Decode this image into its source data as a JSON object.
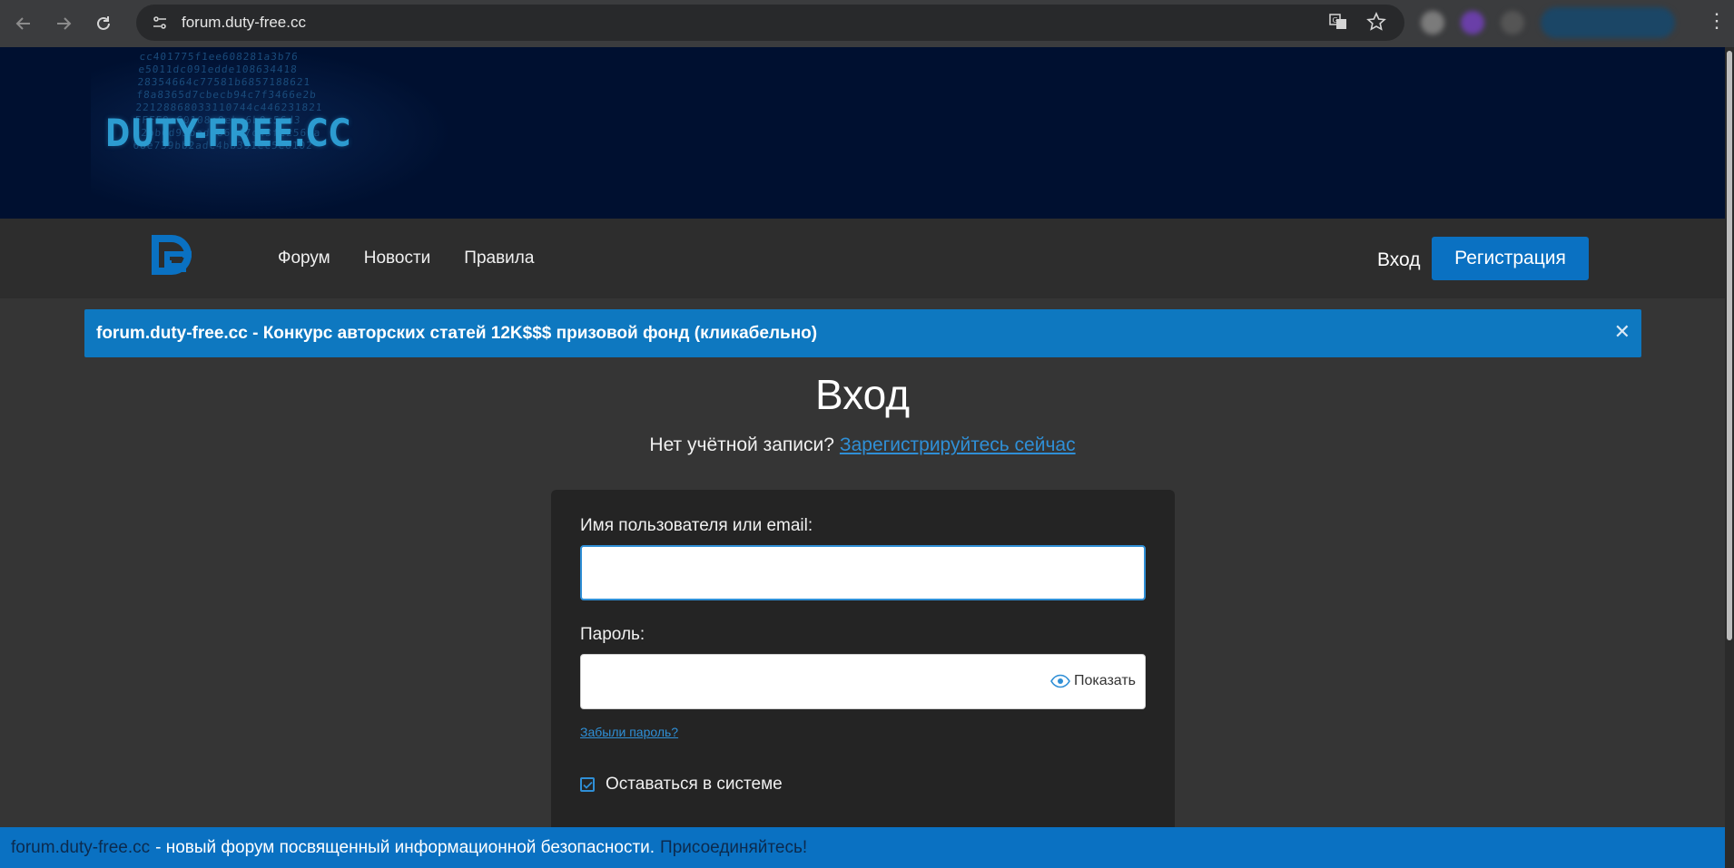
{
  "browser": {
    "url": "forum.duty-free.cc"
  },
  "banner": {
    "logo_text": "DUTY-FREE.CC",
    "code_lines": [
      "cc401775f1ee608281a3b76",
      "e5011dc091edde108634418",
      "28354664c77581b6857188621",
      "f8a8365d7cbecb94c7f3466e2b",
      "22128868033110744c446231821",
      "FFFE9e60108e9ebc6b0c56d3",
      "a2bb6d93bade867f7c43f2256ca",
      "68e739bb2adc4bb391ec5e6102"
    ]
  },
  "nav": {
    "links": [
      "Форум",
      "Новости",
      "Правила"
    ],
    "login": "Вход",
    "register": "Регистрация"
  },
  "notice": {
    "text": "forum.duty-free.cc - Конкурс авторских статей 12K$$$ призовой фонд (кликабельно)",
    "close": "✕"
  },
  "login": {
    "title": "Вход",
    "no_account": "Нет учётной записи?",
    "register_now": "Зарегистрируйтесь сейчас",
    "username_label": "Имя пользователя или email:",
    "username_value": "",
    "password_label": "Пароль:",
    "password_value": "",
    "show_label": "Показать",
    "forgot": "Забыли пароль?",
    "remember_label": "Оставаться в системе",
    "remember_checked": true
  },
  "footer": {
    "site": "forum.duty-free.cc",
    "middle": "- новый форум посвященный информационной безопасности.",
    "join": "Присоединяйтесь!"
  },
  "colors": {
    "accent": "#0a71c2",
    "banner_bg": "#001030",
    "page_bg": "#353535",
    "link": "#2f8fd6"
  }
}
